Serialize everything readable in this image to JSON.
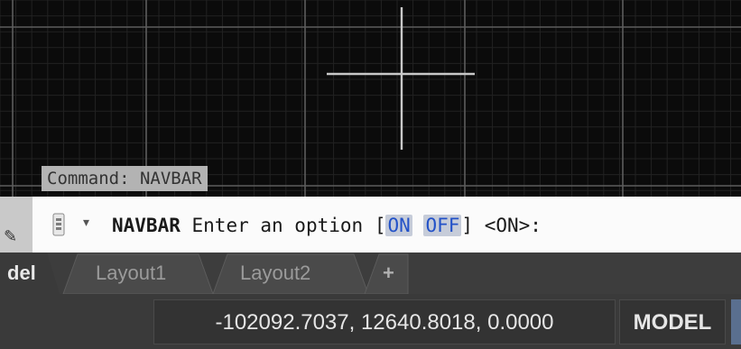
{
  "canvas": {
    "background": "#0b0b0b",
    "grid_major_color": "#5d5d5d",
    "grid_minor_color": "#222222",
    "crosshair_color": "#c8c8c8"
  },
  "command_history": {
    "text": "Command: NAVBAR"
  },
  "command_line": {
    "grip_icon": "pencil-icon",
    "customize_icon": "command-customize-icon",
    "dropdown_icon": "chevron-down-icon",
    "command_name": "NAVBAR",
    "prompt_text": "Enter an option",
    "bracket_open": "[",
    "option_on": "ON",
    "option_off": "OFF",
    "bracket_close": "]",
    "default_value": "<ON>:"
  },
  "tabs": {
    "model": "del",
    "layout1": "Layout1",
    "layout2": "Layout2",
    "add": "+"
  },
  "status_bar": {
    "coordinates": "-102092.7037, 12640.8018, 0.0000",
    "space": "MODEL",
    "accent": "#5a6f8f"
  }
}
